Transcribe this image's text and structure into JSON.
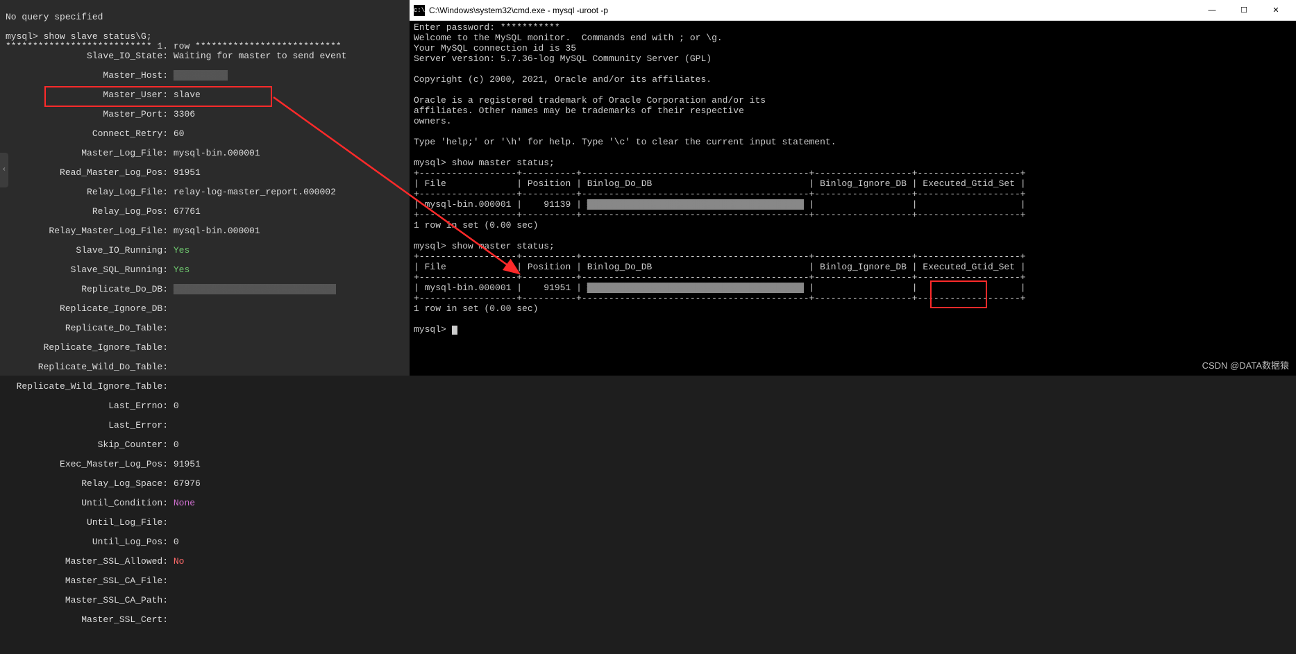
{
  "left": {
    "no_query": "No query specified",
    "prompt": "mysql> show slave status\\G;",
    "row_header": "*************************** 1. row ***************************",
    "fields": {
      "Slave_IO_State": "Waiting for master to send event",
      "Master_Host": "▓▓▓▓▓▓▓▓▓▓",
      "Master_User": "slave",
      "Master_Port": "3306",
      "Connect_Retry": "60",
      "Master_Log_File": "mysql-bin.000001",
      "Read_Master_Log_Pos": "91951",
      "Relay_Log_File": "relay-log-master_report.000002",
      "Relay_Log_Pos": "67761",
      "Relay_Master_Log_File": "mysql-bin.000001",
      "Slave_IO_Running": "Yes",
      "Slave_SQL_Running": "Yes",
      "Replicate_Do_DB": "▓▓▓▓▓▓▓▓▓▓▓▓▓▓▓▓▓▓▓▓▓▓▓▓▓▓▓▓▓▓",
      "Replicate_Ignore_DB": "",
      "Replicate_Do_Table": "",
      "Replicate_Ignore_Table": "",
      "Replicate_Wild_Do_Table": "",
      "Replicate_Wild_Ignore_Table": "",
      "Last_Errno": "0",
      "Last_Error": "",
      "Skip_Counter": "0",
      "Exec_Master_Log_Pos": "91951",
      "Relay_Log_Space": "67976",
      "Until_Condition": "None",
      "Until_Log_File": "",
      "Until_Log_Pos": "0",
      "Master_SSL_Allowed": "No",
      "Master_SSL_CA_File": "",
      "Master_SSL_CA_Path": "",
      "Master_SSL_Cert": ""
    }
  },
  "right": {
    "title": "C:\\Windows\\system32\\cmd.exe - mysql  -uroot -p",
    "lines": {
      "enter_pw": "Enter password: ***********",
      "welcome": "Welcome to the MySQL monitor.  Commands end with ; or \\g.",
      "conn_id": "Your MySQL connection id is 35",
      "version": "Server version: 5.7.36-log MySQL Community Server (GPL)",
      "copyright": "Copyright (c) 2000, 2021, Oracle and/or its affiliates.",
      "trademark1": "Oracle is a registered trademark of Oracle Corporation and/or its",
      "trademark2": "affiliates. Other names may be trademarks of their respective",
      "trademark3": "owners.",
      "help": "Type 'help;' or '\\h' for help. Type '\\c' to clear the current input statement.",
      "cmd1": "mysql> show master status;",
      "cmd2": "mysql> show master status;",
      "cmd3": "mysql> ",
      "rowset": "1 row in set (0.00 sec)"
    },
    "table1": {
      "headers": [
        "File",
        "Position",
        "Binlog_Do_DB",
        "Binlog_Ignore_DB",
        "Executed_Gtid_Set"
      ],
      "row": [
        "mysql-bin.000001",
        "91139",
        "▓▓▓▓▓▓▓▓▓▓▓▓▓▓▓▓▓▓▓▓▓▓▓▓▓▓▓▓▓▓▓▓▓▓▓▓▓▓▓▓",
        "",
        ""
      ]
    },
    "table2": {
      "headers": [
        "File",
        "Position",
        "Binlog_Do_DB",
        "Binlog_Ignore_DB",
        "Executed_Gtid_Set"
      ],
      "row": [
        "mysql-bin.000001",
        "91951",
        "▓▓▓▓▓▓▓▓▓▓▓▓▓▓▓▓▓▓▓▓▓▓▓▓▓▓▓▓▓▓▓▓▓▓▓▓▓▓▓▓",
        "",
        ""
      ]
    }
  },
  "watermark": "CSDN @DATA数据猿"
}
